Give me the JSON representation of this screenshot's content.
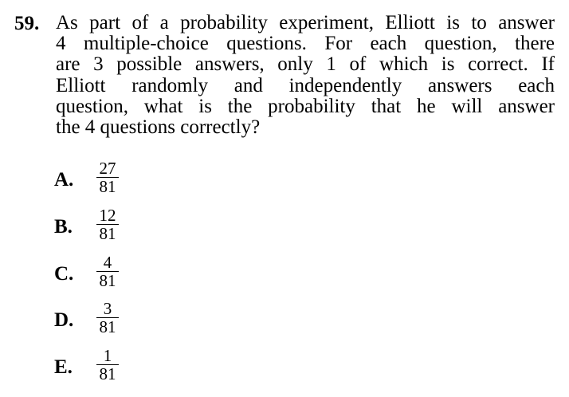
{
  "question": {
    "number": "59.",
    "stem_lines": [
      "As part of a probability experiment, Elliott is to answer",
      "4 multiple-choice questions. For each question, there",
      "are 3 possible answers, only 1 of which is correct. If",
      "Elliott randomly and independently answers each",
      "question, what is the probability that he will answer",
      "the 4 questions correctly?"
    ]
  },
  "choices": [
    {
      "letter": "A.",
      "numerator": "27",
      "denominator": "81"
    },
    {
      "letter": "B.",
      "numerator": "12",
      "denominator": "81"
    },
    {
      "letter": "C.",
      "numerator": "4",
      "denominator": "81"
    },
    {
      "letter": "D.",
      "numerator": "3",
      "denominator": "81"
    },
    {
      "letter": "E.",
      "numerator": "1",
      "denominator": "81"
    }
  ]
}
